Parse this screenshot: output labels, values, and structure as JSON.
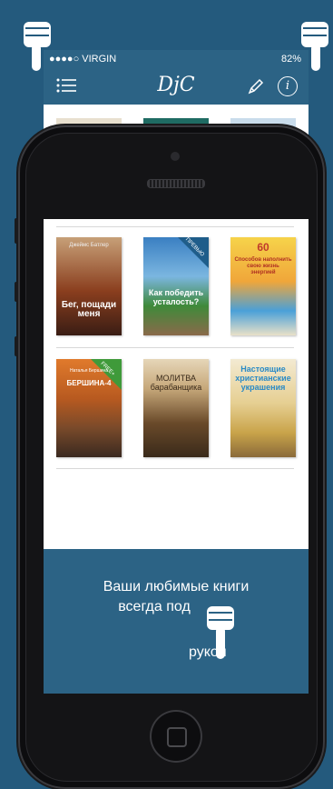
{
  "status_bar": {
    "carrier": "●●●●○ VIRGIN",
    "battery": "82%"
  },
  "navbar": {
    "logo": "DjC"
  },
  "books": [
    {
      "title": "Бег, пощади меня",
      "tag": "",
      "top_label": "Джеймс Батлер"
    },
    {
      "title": "Как победить усталость?",
      "tag": "ПРЕВЬЮ",
      "top_label": ""
    },
    {
      "title": "Способов наполнить свою жизнь энергией",
      "tag": "",
      "top_label": "60"
    },
    {
      "title": "БЕРШИНА-4",
      "tag": "FREE+",
      "top_label": "Наталья Бершина"
    },
    {
      "title": "МОЛИТВА барабанщика",
      "tag": "",
      "top_label": ""
    },
    {
      "title": "Настоящие христианские украшения",
      "tag": "",
      "top_label": ""
    }
  ],
  "promo": {
    "line1": "Ваши любимые книги",
    "line2": "всегда под",
    "line3": "рукой"
  },
  "colors": {
    "background": "#245a7d",
    "accent": "#2c6385"
  },
  "icons": [
    "menu-icon",
    "pencil-icon",
    "info-icon",
    "pointing-hand-icon",
    "home-button"
  ]
}
